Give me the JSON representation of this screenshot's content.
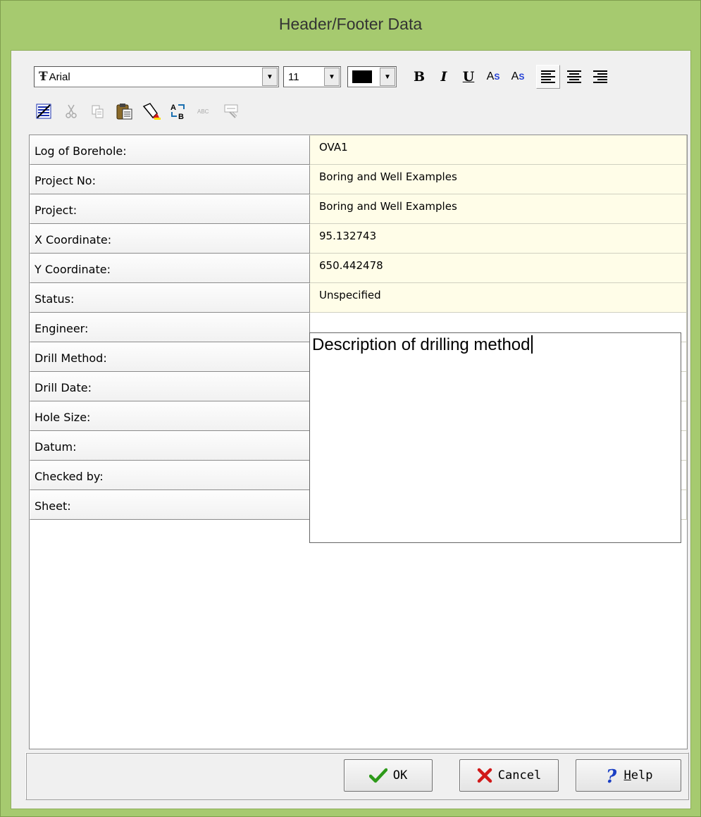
{
  "window": {
    "title": "Header/Footer Data",
    "frame_color": "#a6ca6f"
  },
  "toolbar": {
    "font_name": "Arial",
    "font_size": "11",
    "font_color": "#000000",
    "font_icon": "truetype-font-icon",
    "bold_label": "B",
    "italic_label": "I",
    "underline_label": "U",
    "superscript_base": "A",
    "superscript_mark": "S",
    "subscript_base": "A",
    "subscript_mark": "S",
    "superscript_color": "#1f3cd6",
    "row2_icons": [
      "format-paragraph-icon",
      "cut-icon",
      "copy-icon",
      "paste-icon",
      "highlight-icon",
      "find-replace-icon",
      "spellcheck-icon",
      "insert-field-icon"
    ]
  },
  "fields": [
    {
      "label": "Log of Borehole:",
      "value": "OVA1"
    },
    {
      "label": "Project No:",
      "value": "Boring and Well Examples"
    },
    {
      "label": "Project:",
      "value": "Boring and Well Examples"
    },
    {
      "label": "X Coordinate:",
      "value": "95.132743"
    },
    {
      "label": "Y Coordinate:",
      "value": "650.442478"
    },
    {
      "label": "Status:",
      "value": "Unspecified"
    },
    {
      "label": "Engineer:",
      "value": ""
    },
    {
      "label": "Drill Method:",
      "value": ""
    },
    {
      "label": "Drill Date:",
      "value": ""
    },
    {
      "label": "Hole Size:",
      "value": ""
    },
    {
      "label": "Datum:",
      "value": ""
    },
    {
      "label": "Checked by:",
      "value": ""
    },
    {
      "label": "Sheet:",
      "value": ""
    }
  ],
  "editor": {
    "text": "Description of drilling method"
  },
  "buttons": {
    "ok": "OK",
    "cancel": "Cancel",
    "help_prefix": "H",
    "help_rest": "elp"
  },
  "colors": {
    "value_cell_bg": "#fffde8",
    "ok_check": "#2e9a1a",
    "cancel_x": "#d11a1a",
    "help_q": "#1a3fc4"
  }
}
